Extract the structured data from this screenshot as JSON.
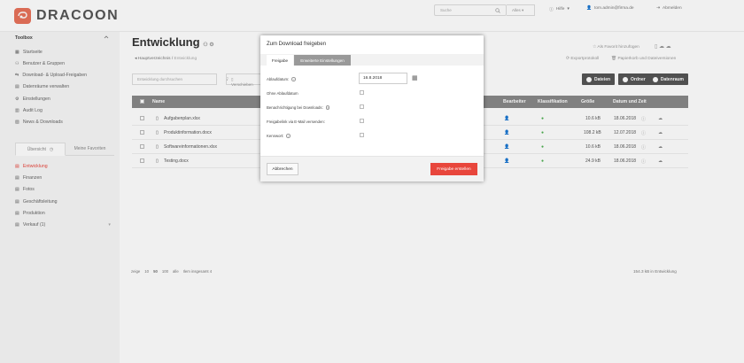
{
  "brand": {
    "name": "DRACOON",
    "color": "#e8725b"
  },
  "top": {
    "search_placeholder": "Suche",
    "search_scope": "Alles",
    "help": "Hilfe",
    "user": "tom.admin@firma.de",
    "logout": "Abmelden"
  },
  "sidebar": {
    "title": "Toolbox",
    "tools": [
      "Startseite",
      "Benutzer & Gruppen",
      "Download- & Upload-Freigaben",
      "Datenräume verwalten",
      "Einstellungen",
      "Audit Log",
      "News & Downloads"
    ],
    "tabs": [
      "Übersicht",
      "Meine Favoriten"
    ],
    "rooms": [
      "Entwicklung",
      "Finanzen",
      "Fotos",
      "Geschäftsleitung",
      "Produktion",
      "Verkauf (1)"
    ]
  },
  "main": {
    "title": "Entwicklung",
    "crumbs": [
      "Hauptverzeichnis",
      "Entwicklung"
    ],
    "add_favorite": "Als Favorit hinzufügen",
    "export": "Exportprotokoll",
    "trash": "Papierkorb und Dateiversionen",
    "filter_placeholder": "Entwicklung durchsuchen",
    "move_label": "Verschieben",
    "buttons": {
      "files": "Dateien",
      "folder": "Ordner",
      "room": "Datenraum"
    },
    "columns": {
      "name": "Name",
      "editor": "Bearbeiter",
      "class": "Klassifikation",
      "size": "Größe",
      "date": "Datum und Zeit"
    },
    "files": [
      {
        "name": "Aufgabenplan.xlsx",
        "size": "10.6 kB",
        "date": "18.06.2018"
      },
      {
        "name": "Produktinformation.docx",
        "size": "108.2 kB",
        "date": "12.07.2018"
      },
      {
        "name": "Softwareinformationen.xlsx",
        "size": "10.6 kB",
        "date": "18.06.2018"
      },
      {
        "name": "Testing.docx",
        "size": "24.9 kB",
        "date": "18.06.2018"
      }
    ],
    "paging": {
      "label": "zeige",
      "options": [
        "10",
        "50",
        "100",
        "alle"
      ],
      "total": "Ilem insgesamt 4"
    },
    "summary": "154.3 kB in Entwicklung"
  },
  "dialog": {
    "title": "Zum Download freigeben",
    "tabs": [
      "Freigabe",
      "Erweiterte Einstellungen"
    ],
    "fields": {
      "expiry_label": "Ablaufdatum:",
      "expiry_value": "16.8.2018",
      "no_expiry": "Ohne Ablaufdatum",
      "notify": "Benachrichtigung bei Downloads:",
      "email_link": "Freigabelink via E-Mail versenden:",
      "password": "Kennwort:"
    },
    "cancel": "Abbrechen",
    "create": "Freigabe erstellen"
  },
  "colors": {
    "accent": "#e8463c",
    "green": "#4caf50",
    "header": "#888888",
    "dark_btn": "#555555"
  }
}
